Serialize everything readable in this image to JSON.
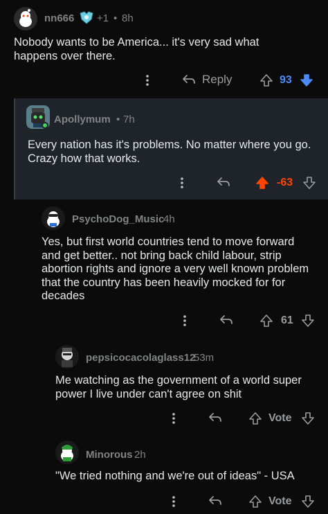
{
  "comments": [
    {
      "username": "nn666",
      "award_count": "+1",
      "time": "8h",
      "text": "Nobody wants to be America... it's very sad what happens over there.",
      "reply_label": "Reply",
      "score": "93",
      "vote_state": "downvoted",
      "score_color": "#4c8bf5"
    },
    {
      "username": "Apollymum",
      "time": "7h",
      "text": "Every nation has it's problems. No matter where you go. Crazy how that works.",
      "score": "-63",
      "vote_state": "upvoted",
      "score_color": "#ff4500"
    },
    {
      "username": "PsychoDog_Music",
      "time": "4h",
      "text": "Yes, but first world countries tend to move forward and get better.. not bring back child labour, strip abortion rights and ignore a very well known problem that the country has been heavily mocked for for decades",
      "score": "61",
      "vote_state": "none"
    },
    {
      "username": "pepsicocacolaglass12",
      "time": "53m",
      "text": "Me watching as the government of a world super power I live under can't agree on shit",
      "score": "Vote",
      "vote_state": "none"
    },
    {
      "username": "Minorous",
      "time": "2h",
      "text": "\"We tried nothing and we're out of ideas\" - USA",
      "score": "Vote",
      "vote_state": "none"
    }
  ],
  "icons": {
    "more": "more-options-icon",
    "reply": "reply-arrow-icon",
    "upvote": "upvote-arrow-icon",
    "downvote": "downvote-arrow-icon",
    "award": "award-icon"
  }
}
